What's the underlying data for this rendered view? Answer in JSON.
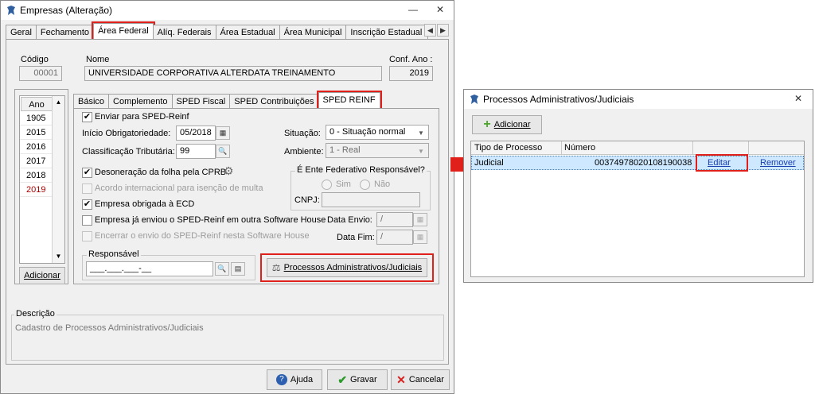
{
  "main": {
    "title": "Empresas (Alteração)",
    "tabs": [
      "Geral",
      "Fechamento",
      "Área Federal",
      "Alíq. Federais",
      "Área Estadual",
      "Área Municipal",
      "Inscrição Estadual S"
    ],
    "codigo_label": "Código",
    "codigo_value": "00001",
    "nome_label": "Nome",
    "nome_value": "UNIVERSIDADE CORPORATIVA ALTERDATA TREINAMENTO",
    "conf_label": "Conf. Ano :",
    "conf_value": "2019",
    "years_header": "Ano",
    "years": [
      "1905",
      "2015",
      "2016",
      "2017",
      "2018",
      "2019"
    ],
    "years_selected": "2019",
    "adicionar": "Adicionar",
    "subtabs": [
      "Básico",
      "Complemento",
      "SPED Fiscal",
      "SPED Contribuições",
      "SPED REINF"
    ],
    "enviar": "Enviar para SPED-Reinf",
    "inicio_label": "Início Obrigatoriedade:",
    "inicio_value": "05/2018",
    "classif_label": "Classificação Tributária:",
    "classif_value": "99",
    "situacao_label": "Situação:",
    "situacao_value": "0 - Situação normal",
    "ambiente_label": "Ambiente:",
    "ambiente_value": "1 - Real",
    "desoneracao": "Desoneração da folha pela CPRB",
    "acordo": "Acordo internacional para isenção de multa",
    "ecd": "Empresa obrigada à ECD",
    "enviou": "Empresa já enviou o SPED-Reinf em outra Software House",
    "encerrar": "Encerrar o envio do SPED-Reinf nesta Software House",
    "ente_label": "É Ente Federativo Responsável?",
    "sim": "Sim",
    "nao": "Não",
    "cnpj_label": "CNPJ:",
    "data_envio_label": "Data Envio:",
    "data_fim_label": "Data Fim:",
    "date_placeholder": "/",
    "responsavel_label": "Responsável",
    "responsavel_value": "___.___.___-__",
    "processos_button": "Processos Administrativos/Judiciais",
    "descricao_label": "Descrição",
    "descricao_value": "Cadastro de Processos Administrativos/Judiciais",
    "ajuda": "Ajuda",
    "gravar": "Gravar",
    "cancelar": "Cancelar"
  },
  "dialog": {
    "title": "Processos Administrativos/Judiciais",
    "adicionar": "Adicionar",
    "col_tipo": "Tipo de Processo",
    "col_numero": "Número",
    "row_tipo": "Judicial",
    "row_numero": "00374978020108190038",
    "editar": "Editar",
    "remover": "Remover"
  },
  "colors": {
    "highlight": "#e0211b",
    "selected_row": "#cde8ff",
    "link": "#1a3fae",
    "year_selected": "#b00000"
  }
}
